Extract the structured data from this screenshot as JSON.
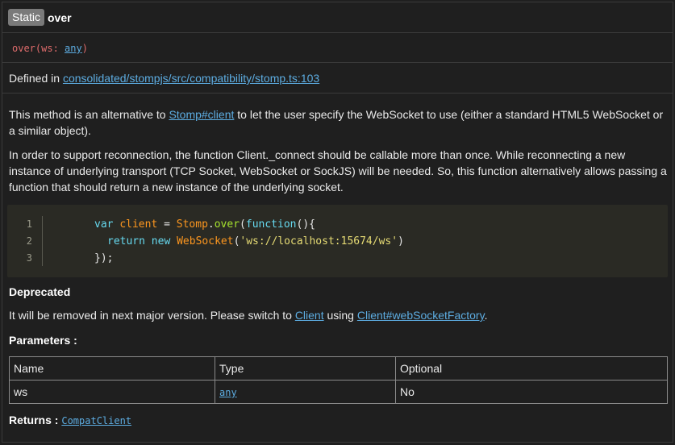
{
  "header": {
    "badge": "Static",
    "method": "over"
  },
  "signature": {
    "name": "over",
    "open": "(",
    "param": "ws",
    "sep": ": ",
    "type": "any",
    "close": ")"
  },
  "defined": {
    "prefix": "Defined in ",
    "link": "consolidated/stompjs/src/compatibility/stomp.ts:103"
  },
  "description": {
    "p1_a": "This method is an alternative to ",
    "p1_link": "Stomp#client",
    "p1_b": " to let the user specify the WebSocket to use (either a standard HTML5 WebSocket or a similar object).",
    "p2": "In order to support reconnection, the function Client._connect should be callable more than once. While reconnecting a new instance of underlying transport (TCP Socket, WebSocket or SockJS) will be needed. So, this function alternatively allows passing a function that should return a new instance of the underlying socket."
  },
  "code": {
    "line_numbers": [
      "1",
      "2",
      "3"
    ],
    "l1": {
      "kw1": "var",
      "v": "client",
      "eq": " = ",
      "cls": "Stomp",
      "dot": ".",
      "fn": "over",
      "p1": "(",
      "kw2": "function",
      "rest": "(){"
    },
    "l2": {
      "kw1": "return",
      "kw2": "new",
      "cls": "WebSocket",
      "p1": "(",
      "str": "'ws://localhost:15674/ws'",
      "p2": ")"
    },
    "l3": {
      "text": "});"
    }
  },
  "deprecated": {
    "heading": "Deprecated",
    "a": "It will be removed in next major version. Please switch to ",
    "link1": "Client",
    "b": " using ",
    "link2": "Client#webSocketFactory",
    "c": "."
  },
  "parameters": {
    "heading": "Parameters :",
    "columns": [
      "Name",
      "Type",
      "Optional"
    ],
    "rows": [
      {
        "name": "ws",
        "type": "any",
        "optional": "No"
      }
    ]
  },
  "returns": {
    "label": "Returns : ",
    "type": "CompatClient"
  }
}
